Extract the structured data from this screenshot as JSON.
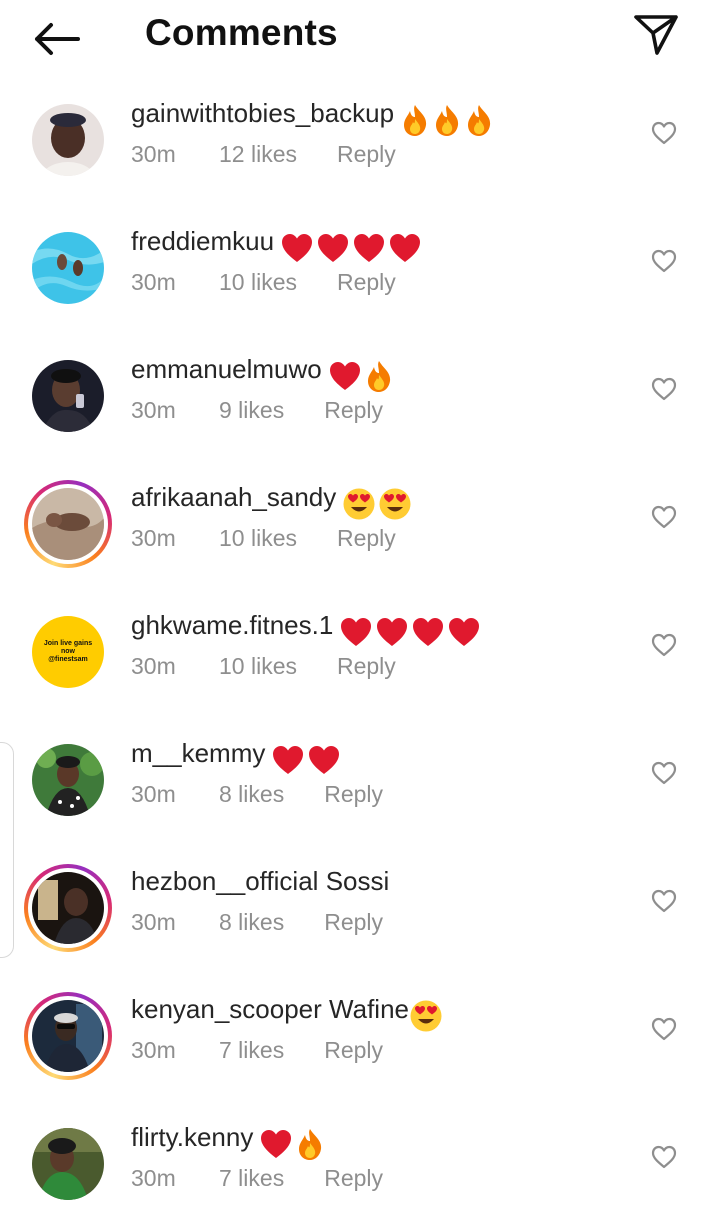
{
  "header": {
    "title": "Comments",
    "back_icon": "arrow-left-icon",
    "send_icon": "paper-plane-icon"
  },
  "colors": {
    "text": "#262626",
    "meta": "#8e8e8e",
    "heart_red": "#e0192e",
    "story_ring_start": "#feda75",
    "story_ring_end": "#d62976"
  },
  "comments": [
    {
      "username": "gainwithtobies_backup",
      "text": "",
      "emojis": [
        "fire",
        "fire",
        "fire"
      ],
      "time": "30m",
      "likes": "12 likes",
      "reply": "Reply",
      "story_ring": false
    },
    {
      "username": "freddiemkuu",
      "text": "",
      "emojis": [
        "red-heart",
        "red-heart",
        "red-heart",
        "red-heart"
      ],
      "time": "30m",
      "likes": "10 likes",
      "reply": "Reply",
      "story_ring": false
    },
    {
      "username": "emmanuelmuwo",
      "text": "",
      "emojis": [
        "red-heart",
        "fire"
      ],
      "time": "30m",
      "likes": "9 likes",
      "reply": "Reply",
      "story_ring": false
    },
    {
      "username": "afrikaanah_sandy",
      "text": "",
      "emojis": [
        "heart-eyes",
        "heart-eyes"
      ],
      "time": "30m",
      "likes": "10 likes",
      "reply": "Reply",
      "story_ring": true
    },
    {
      "username": "ghkwame.fitnes.1",
      "text": "",
      "emojis": [
        "red-heart",
        "red-heart",
        "red-heart",
        "red-heart"
      ],
      "time": "30m",
      "likes": "10 likes",
      "reply": "Reply",
      "story_ring": false,
      "avatar_text": "Join live gains now @finestsam"
    },
    {
      "username": "m__kemmy",
      "text": "",
      "emojis": [
        "red-heart",
        "red-heart"
      ],
      "time": "30m",
      "likes": "8 likes",
      "reply": "Reply",
      "story_ring": false
    },
    {
      "username": "hezbon__official",
      "text": "Sossi",
      "emojis": [],
      "time": "30m",
      "likes": "8 likes",
      "reply": "Reply",
      "story_ring": true
    },
    {
      "username": "kenyan_scooper",
      "text": "Wafine",
      "emojis": [
        "heart-eyes"
      ],
      "time": "30m",
      "likes": "7 likes",
      "reply": "Reply",
      "story_ring": true
    },
    {
      "username": "flirty.kenny",
      "text": "",
      "emojis": [
        "red-heart",
        "fire"
      ],
      "time": "30m",
      "likes": "7 likes",
      "reply": "Reply",
      "story_ring": false
    }
  ]
}
